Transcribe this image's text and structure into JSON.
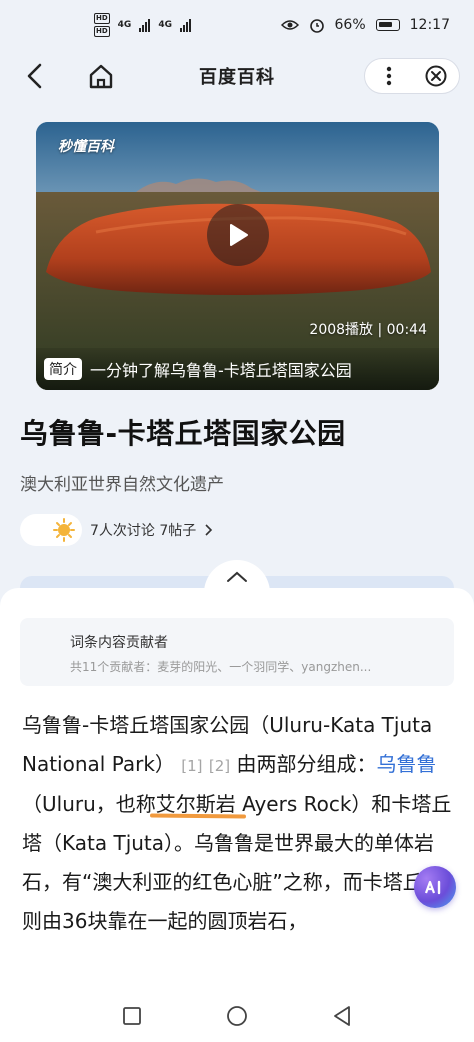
{
  "status_bar": {
    "hd1": "HD",
    "hd2": "HD",
    "net1": "4G",
    "net2": "4G",
    "battery": "66%",
    "time": "12:17"
  },
  "nav": {
    "title": "百度百科"
  },
  "video": {
    "logo": "秒懂百科",
    "meta": "2008播放 | 00:44",
    "caption_tag": "简介",
    "caption": "一分钟了解乌鲁鲁-卡塔丘塔国家公园"
  },
  "entry": {
    "title": "乌鲁鲁-卡塔丘塔国家公园",
    "subtitle": "澳大利亚世界自然文化遗产",
    "discussion": "7人次讨论  7帖子"
  },
  "contributors": {
    "title": "词条内容贡献者",
    "list": "共11个贡献者：麦芽的阳光、一个羽同学、yangzhen..."
  },
  "article": {
    "p1_a": "乌鲁鲁-卡塔丘塔国家公园（Uluru-Kata Tjuta National Park）",
    "ref1": "[1]",
    "ref2": "[2]",
    "p1_b": "由两部分组成：",
    "link": "乌鲁鲁",
    "p1_c": "（Uluru，也称",
    "highlight": "艾尔斯岩",
    "p1_d": " Ayers Rock）和卡塔丘塔（Kata Tjuta）。乌鲁鲁是世界最大的单体岩石，有“澳大利亚的红色心脏”之称，而卡塔丘塔则由36块靠在一起的圆顶岩石，"
  },
  "colors": {
    "accent": "#3370d6",
    "highlight_underline": "#f19a3e",
    "background": "#eef2f8"
  }
}
